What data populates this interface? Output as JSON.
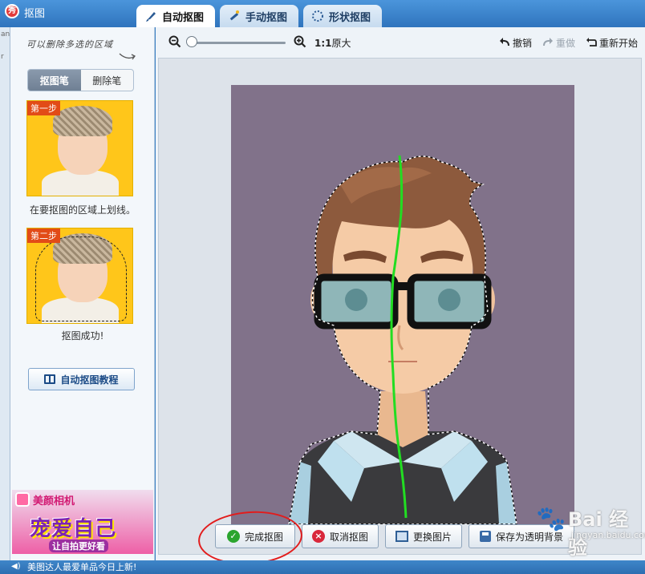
{
  "window": {
    "title": "抠图",
    "app_badge": "秀"
  },
  "tabs": [
    {
      "label": "自动抠图",
      "active": true,
      "icon": "brush-icon"
    },
    {
      "label": "手动抠图",
      "active": false,
      "icon": "magic-wand-icon"
    },
    {
      "label": "形状抠图",
      "active": false,
      "icon": "shape-icon"
    }
  ],
  "left_panel": {
    "hint": "可以删除多选的区域",
    "tools": [
      {
        "label": "抠图笔",
        "active": true
      },
      {
        "label": "删除笔",
        "active": false
      }
    ],
    "steps": [
      {
        "badge": "第一步",
        "caption": "在要抠图的区域上划线。"
      },
      {
        "badge": "第二步",
        "caption": "抠图成功!"
      }
    ],
    "tutorial_label": "自动抠图教程",
    "ad": {
      "brand": "美颜相机",
      "headline": "宠爱自己",
      "subline": "让自拍更好看"
    }
  },
  "edge_text": [
    "an",
    "r"
  ],
  "toolbar": {
    "zoom_level": 0,
    "ratio_bold": "1:1",
    "ratio_label": "原大",
    "undo_label": "撤销",
    "redo_label": "重做",
    "restart_label": "重新开始"
  },
  "actions": {
    "finish_label": "完成抠图",
    "cancel_label": "取消抠图",
    "replace_label": "更换图片",
    "save_label": "保存为透明背景"
  },
  "watermark": {
    "title": "Bai 经验",
    "url": "jingyan.baidu.com"
  },
  "status_text": "美图达人最爱单品今日上新!",
  "colors": {
    "accent": "#2f74bd",
    "photo_bg": "#81728a",
    "stroke": "#22dd22",
    "annotation": "#e21c1c"
  }
}
